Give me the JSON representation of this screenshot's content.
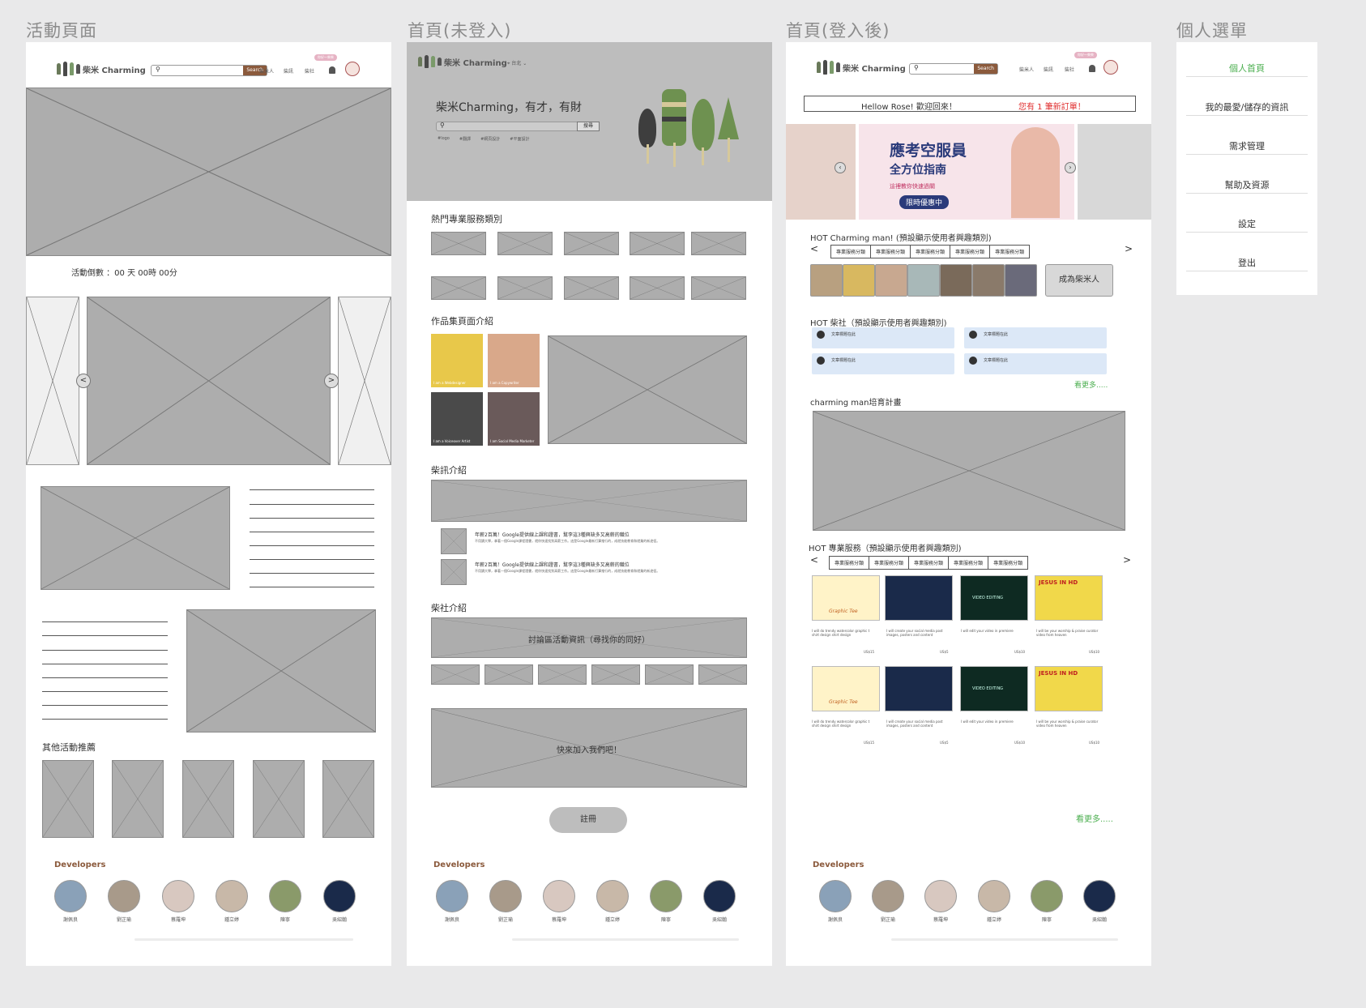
{
  "frames": {
    "activity": "活動頁面",
    "home_guest": "首頁(未登入)",
    "home_user": "首頁(登入後)",
    "menu": "個人選單"
  },
  "header": {
    "logo": "柴米 Charming",
    "search_btn": "Search",
    "nav": [
      "柴米人",
      "柴訊",
      "柴社"
    ],
    "badge": "你好～柴柴"
  },
  "activity": {
    "countdown": "活動倒數 ：00 天 00時 00分",
    "arrow_left": "<",
    "arrow_right": ">",
    "other_title": "其他活動推薦"
  },
  "guest": {
    "location": "台北",
    "slogan": "柴米Charming，有才，有財",
    "search_btn": "搜尋",
    "tags": [
      "#logo",
      "#翻譯",
      "#網頁設計",
      "#平面設計"
    ],
    "hot_services": "熱門專業服務類別",
    "portfolio": "作品集頁面介紹",
    "portfolio_captions": [
      "I am a Webdesigner",
      "I am a Copywriter",
      "I am a Voiceover Artist",
      "I am Social Media Marketer"
    ],
    "news_title": "柴訊介紹",
    "news_items": [
      {
        "title": "年薪2百萬！Google提供線上課和證書，幫李這3種興缺多又高薪的職位",
        "body": "不用讀大學，拿著一個Google課程證書，就你快速找到高薪工作。這是Google最新打算推行的，成就技能教育和就業的新途徑。"
      },
      {
        "title": "年薪2百萬！Google提供線上課和證書，幫李這3種興缺多又高薪的職位",
        "body": "不用讀大學，拿著一個Google課程證書，就你快速找到高薪工作。這是Google最新打算推行的，成就技能教育和就業的新途徑。"
      }
    ],
    "club_title": "柴社介紹",
    "club_banner": "討論區活動資訊（尋找你的同好）",
    "join_banner": "快來加入我們吧！",
    "register": "註冊"
  },
  "user": {
    "welcome": "Hellow   Rose!  歡迎回來！",
    "orders": "您有 1 筆新訂單！",
    "promo_line1": "應考空服員",
    "promo_line2": "全方位指南",
    "promo_line3": "這裡教你快速過關",
    "promo_cta": "限時優惠中",
    "hot_man": "HOT Charming man!  (預設顯示使用者興趣類別)",
    "tabs": [
      "專業服務分類",
      "專業服務分類",
      "專業服務分類",
      "專業服務分類",
      "專業服務分類"
    ],
    "become": "成為柴米人",
    "hot_club": "HOT 柴社（預設顯示使用者興趣類別)",
    "post_title": "文章標題在此",
    "more": "看更多.....",
    "training": "charming man培育計畫",
    "hot_services": "HOT 專業服務（預設顯示使用者興趣類別)",
    "svc_descs": [
      "I will do trendy watercolor graphic t shirt design shirt design",
      "I will create your social media post images, posters and content",
      "I will edit your video in premiere",
      "I will be your worship & praise curator video from heaven"
    ],
    "svc_prices": [
      "US$15",
      "US$5",
      "US$10",
      "US$10"
    ],
    "svc_labels": [
      "Graphic Tee",
      "",
      "VIDEO EDITING",
      "JESUS IN HD"
    ]
  },
  "developers": {
    "title": "Developers",
    "names": [
      "謝佩良",
      "劉芷瑜",
      "蔡羅坤",
      "鍾立婷",
      "陳寧",
      "吳紹翰"
    ]
  },
  "menu": {
    "items": [
      "個人首頁",
      "我的最愛/儲存的資訊",
      "需求管理",
      "幫助及資源",
      "設定",
      "登出"
    ],
    "active_color": "#4caf50"
  }
}
